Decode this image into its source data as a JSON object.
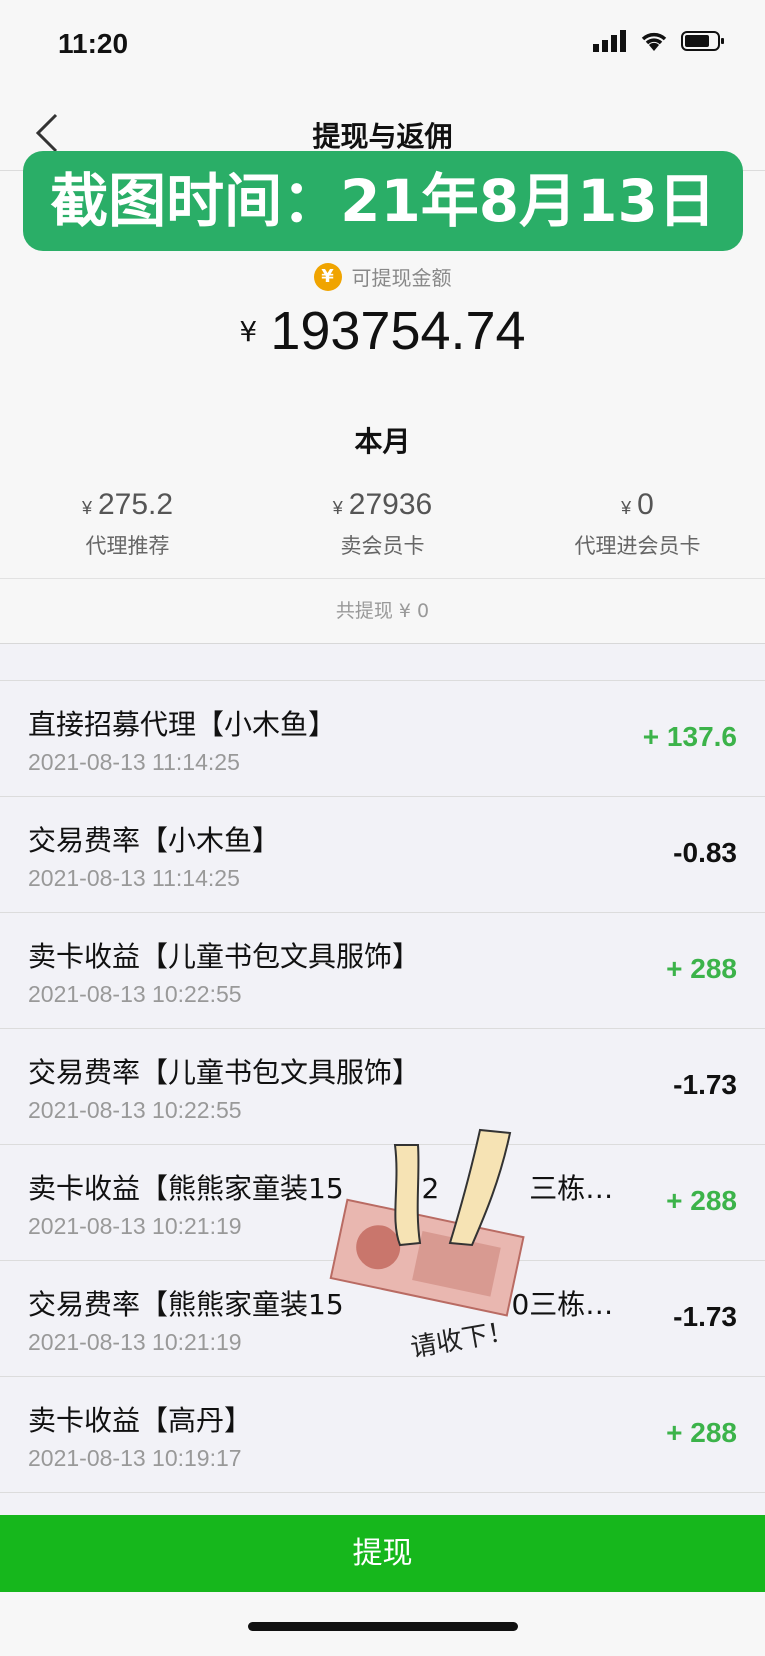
{
  "status_bar": {
    "time": "11:20"
  },
  "nav": {
    "title": "提现与返佣"
  },
  "banner": {
    "text": "截图时间：21年8月13日"
  },
  "summary": {
    "balance_label": "可提现金额",
    "balance_icon": "yen-coin-icon",
    "currency_symbol": "¥",
    "balance": "193754.74",
    "month_title": "本月",
    "stats": [
      {
        "currency": "¥",
        "value": "275.2",
        "label": "代理推荐"
      },
      {
        "currency": "¥",
        "value": "27936",
        "label": "卖会员卡"
      },
      {
        "currency": "¥",
        "value": "0",
        "label": "代理进会员卡"
      }
    ],
    "total_withdrawn": "共提现 ¥ 0"
  },
  "transactions": [
    {
      "title": "直接招募代理【小木鱼】",
      "time": "2021-08-13 11:14:25",
      "amount": "+ 137.6",
      "type": "positive"
    },
    {
      "title": "交易费率【小木鱼】",
      "time": "2021-08-13 11:14:25",
      "amount": "-0.83",
      "type": "negative"
    },
    {
      "title": "卖卡收益【儿童书包文具服饰】",
      "time": "2021-08-13 10:22:55",
      "amount": "+ 288",
      "type": "positive"
    },
    {
      "title": "交易费率【儿童书包文具服饰】",
      "time": "2021-08-13 10:22:55",
      "amount": "-1.73",
      "type": "negative"
    },
    {
      "title": "卖卡收益【熊熊家童装15",
      "title_tail": "72",
      "title_end": "三栋…",
      "time": "2021-08-13 10:21:19",
      "amount": "+ 288",
      "type": "positive"
    },
    {
      "title": "交易费率【熊熊家童装15",
      "title_tail": "70三栋…",
      "title_end": "",
      "time": "2021-08-13 10:21:19",
      "amount": "-1.73",
      "type": "negative"
    },
    {
      "title": "卖卡收益【高丹】",
      "time": "2021-08-13 10:19:17",
      "amount": "+ 288",
      "type": "positive"
    }
  ],
  "sticker": {
    "caption": "请收下！"
  },
  "withdraw_button": {
    "label": "提现"
  },
  "colors": {
    "accent_green": "#16b71c",
    "positive_amount": "#3cb34a",
    "banner_green": "#2aae67"
  }
}
